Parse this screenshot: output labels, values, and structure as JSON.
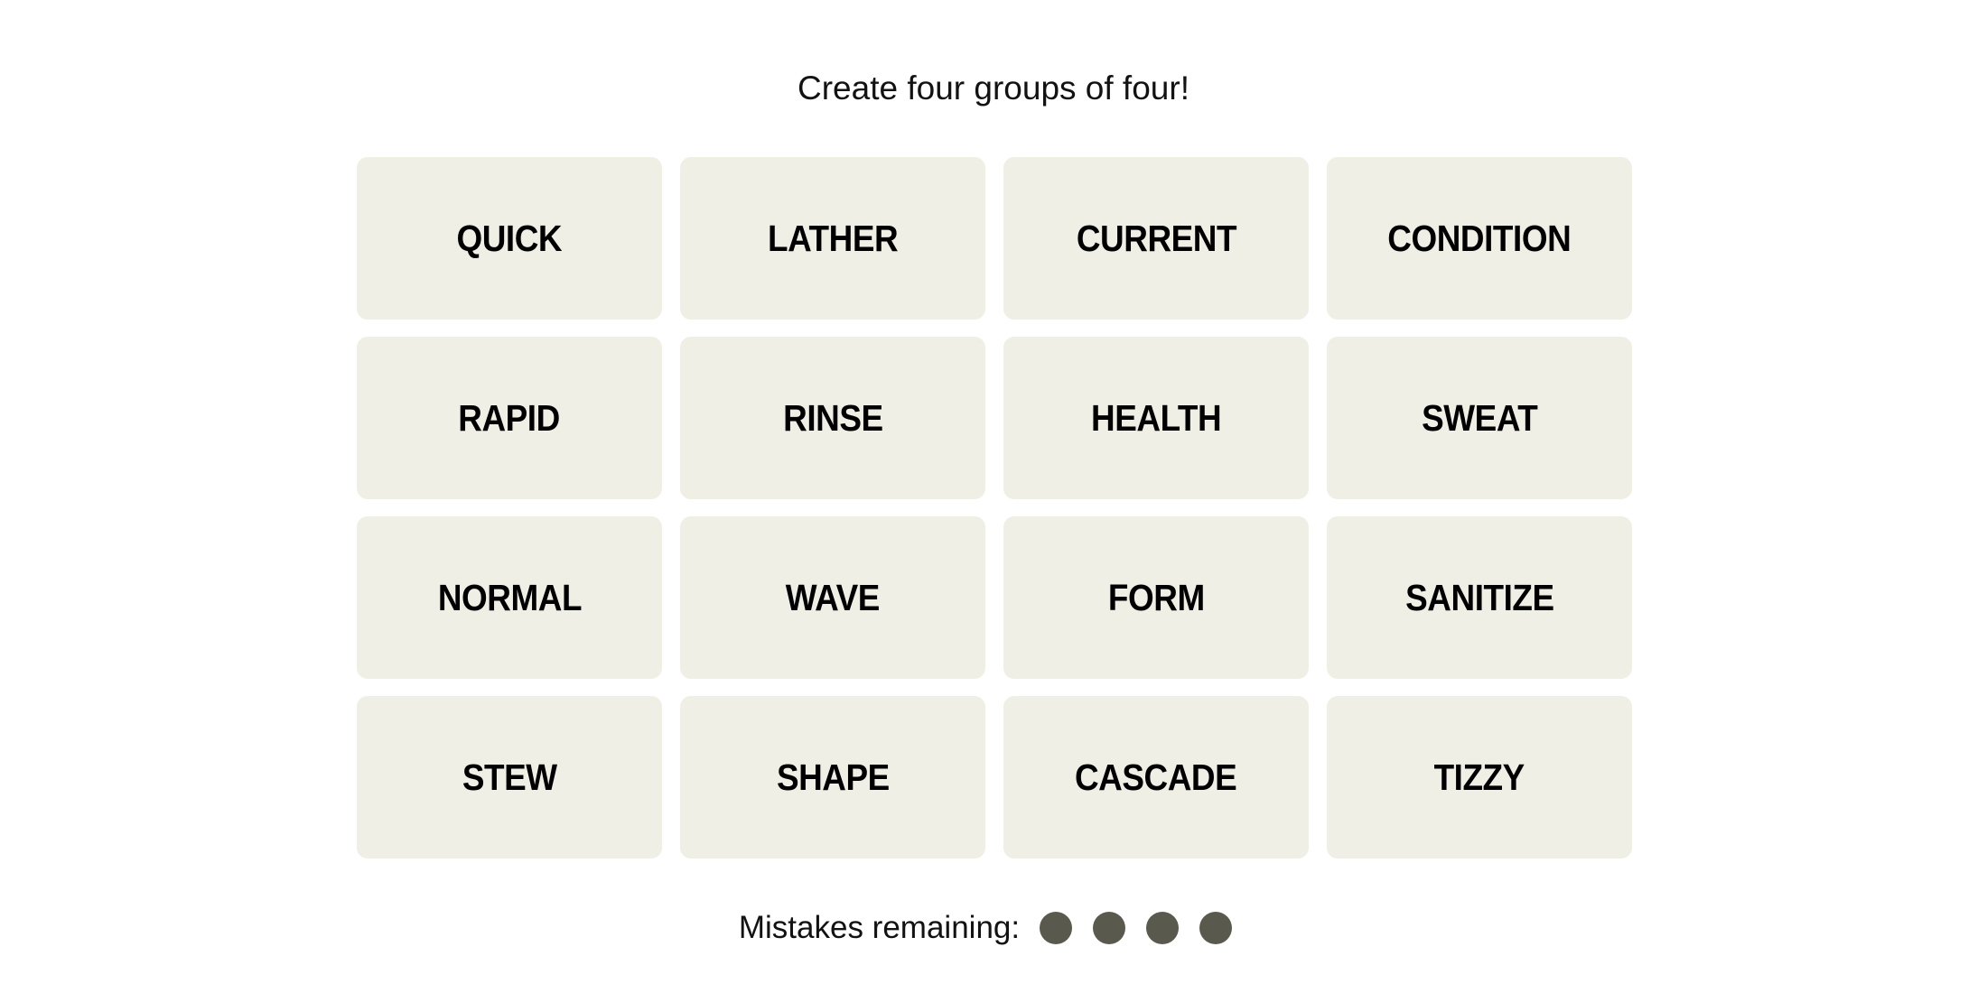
{
  "header": {
    "subtitle": "Create four groups of four!"
  },
  "board": {
    "tiles": [
      {
        "label": "QUICK",
        "selected": false
      },
      {
        "label": "LATHER",
        "selected": false
      },
      {
        "label": "CURRENT",
        "selected": false
      },
      {
        "label": "CONDITION",
        "selected": false
      },
      {
        "label": "RAPID",
        "selected": false
      },
      {
        "label": "RINSE",
        "selected": false
      },
      {
        "label": "HEALTH",
        "selected": false
      },
      {
        "label": "SWEAT",
        "selected": false
      },
      {
        "label": "NORMAL",
        "selected": false
      },
      {
        "label": "WAVE",
        "selected": false
      },
      {
        "label": "FORM",
        "selected": false
      },
      {
        "label": "SANITIZE",
        "selected": false
      },
      {
        "label": "STEW",
        "selected": false
      },
      {
        "label": "SHAPE",
        "selected": false
      },
      {
        "label": "CASCADE",
        "selected": false
      },
      {
        "label": "TIZZY",
        "selected": false
      }
    ]
  },
  "mistakes": {
    "label": "Mistakes remaining:",
    "remaining": 4,
    "total": 4,
    "dot_color": "#5a594e"
  },
  "colors": {
    "tile_background": "#efefe6",
    "tile_text": "#000000",
    "page_background": "#ffffff"
  }
}
